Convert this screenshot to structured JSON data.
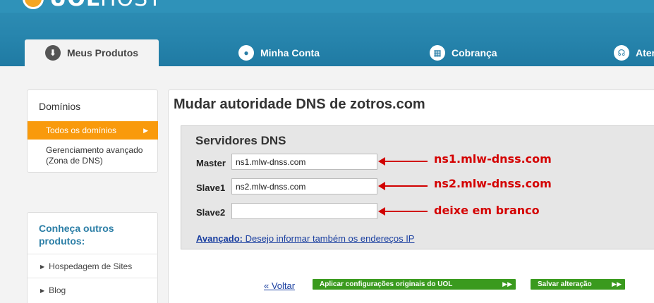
{
  "header": {
    "logo_bold": "UOL",
    "logo_light": "HOST",
    "tabs": [
      {
        "label": "Meus Produtos",
        "icon": "download-icon",
        "active": true
      },
      {
        "label": "Minha Conta",
        "icon": "user-icon"
      },
      {
        "label": "Cobrança",
        "icon": "calculator-icon"
      },
      {
        "label": "Ater",
        "icon": "headset-icon"
      }
    ]
  },
  "sidebar": {
    "domains": {
      "title": "Domínios",
      "items": [
        {
          "label": "Todos os domínios",
          "active": true
        },
        {
          "label": "Gerenciamento avançado (Zona de DNS)"
        }
      ]
    },
    "products": {
      "title": "Conheça outros produtos:",
      "items": [
        {
          "label": "Hospedagem de Sites"
        },
        {
          "label": "Blog"
        }
      ]
    }
  },
  "main": {
    "title": "Mudar autoridade DNS de zotros.com",
    "dns_box": {
      "title": "Servidores DNS",
      "fields": [
        {
          "label": "Master",
          "value": "ns1.mlw-dnss.com",
          "note": "ns1.mlw-dnss.com"
        },
        {
          "label": "Slave1",
          "value": "ns2.mlw-dnss.com",
          "note": "ns2.mlw-dnss.com"
        },
        {
          "label": "Slave2",
          "value": "",
          "note": "deixe em branco"
        }
      ],
      "advanced_bold": "Avançado:",
      "advanced_text": " Desejo informar também os endereços IP"
    },
    "back_label": "« Voltar",
    "btn_original": "Aplicar configurações originais do UOL",
    "btn_save": "Salvar alteração"
  },
  "colors": {
    "header_blue": "#2785ad",
    "accent_orange": "#f99a0c",
    "button_green": "#3a9a1e",
    "annotation_red": "#d40000"
  }
}
